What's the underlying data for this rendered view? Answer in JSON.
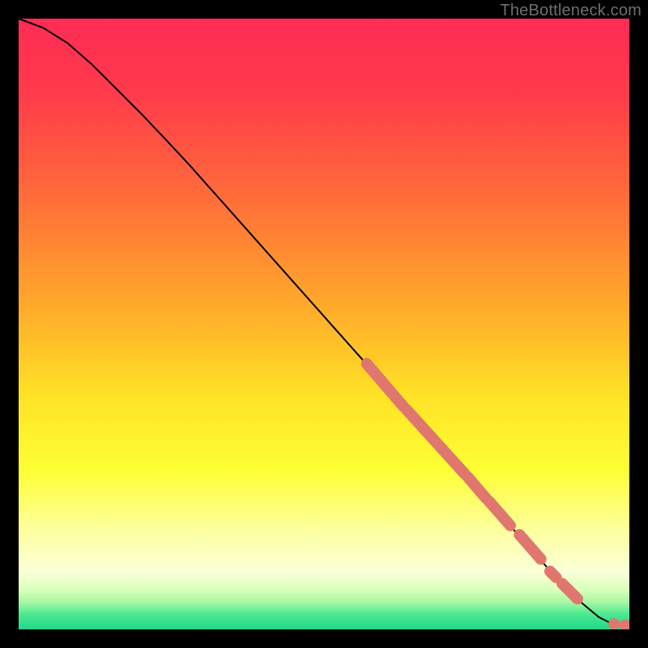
{
  "attribution": "TheBottleneck.com",
  "chart_data": {
    "type": "line",
    "title": "",
    "xlabel": "",
    "ylabel": "",
    "xlim": [
      0,
      100
    ],
    "ylim": [
      0,
      100
    ],
    "curve": {
      "name": "bottleneck-curve",
      "x": [
        0,
        4,
        8,
        12,
        16,
        20,
        24,
        28,
        32,
        36,
        40,
        44,
        48,
        52,
        56,
        60,
        64,
        68,
        72,
        76,
        80,
        84,
        88,
        92,
        95,
        97,
        98.5,
        100
      ],
      "y": [
        100,
        98.5,
        96,
        92.5,
        88.5,
        84.5,
        80.3,
        76,
        71.5,
        67,
        62.5,
        58,
        53.5,
        49,
        44.5,
        40,
        35.5,
        31,
        26.5,
        22,
        17.5,
        13,
        8.5,
        4.5,
        2,
        1,
        0.7,
        0.7
      ]
    },
    "highlighted_segments": [
      {
        "x0": 57,
        "y0": 43.5,
        "x1": 63,
        "y1": 36.5
      },
      {
        "x0": 63.5,
        "y0": 36,
        "x1": 73,
        "y1": 25.5
      },
      {
        "x0": 73.5,
        "y0": 25,
        "x1": 76.5,
        "y1": 21.5
      },
      {
        "x0": 77,
        "y0": 21,
        "x1": 80.5,
        "y1": 17
      },
      {
        "x0": 82,
        "y0": 15.5,
        "x1": 85.5,
        "y1": 11.5
      },
      {
        "x0": 87,
        "y0": 9.5,
        "x1": 88,
        "y1": 8.5
      },
      {
        "x0": 89,
        "y0": 7.5,
        "x1": 91.5,
        "y1": 5
      }
    ],
    "highlighted_points": [
      {
        "x": 97.5,
        "y": 0.9
      },
      {
        "x": 99.3,
        "y": 0.7
      }
    ],
    "gradient_stops": [
      {
        "offset": 0.0,
        "color": "#ff2b55"
      },
      {
        "offset": 0.12,
        "color": "#ff3a4b"
      },
      {
        "offset": 0.3,
        "color": "#ff6f39"
      },
      {
        "offset": 0.48,
        "color": "#ffad2a"
      },
      {
        "offset": 0.62,
        "color": "#ffe326"
      },
      {
        "offset": 0.74,
        "color": "#feff35"
      },
      {
        "offset": 0.84,
        "color": "#fdffa0"
      },
      {
        "offset": 0.905,
        "color": "#fbffd8"
      },
      {
        "offset": 0.935,
        "color": "#d9ffba"
      },
      {
        "offset": 0.955,
        "color": "#a9f8a3"
      },
      {
        "offset": 0.975,
        "color": "#4de892"
      },
      {
        "offset": 1.0,
        "color": "#1fd98b"
      }
    ],
    "marker_color": "#e0776f",
    "curve_color": "#000000"
  }
}
